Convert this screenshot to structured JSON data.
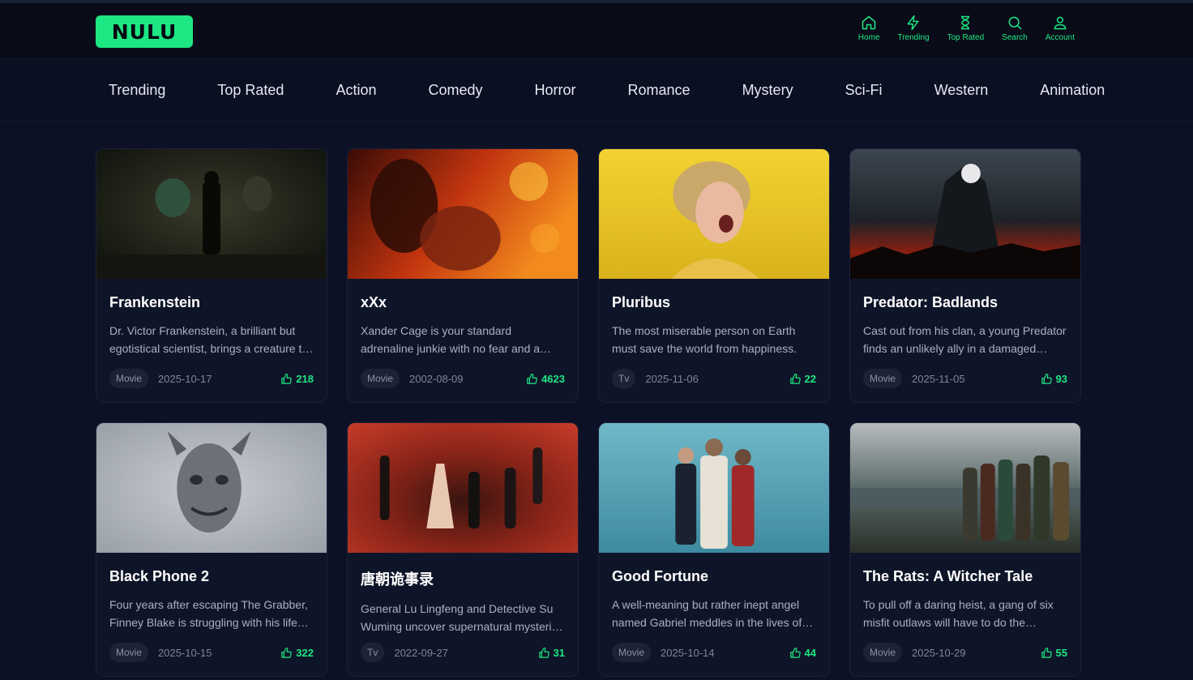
{
  "brand": {
    "name": "NULU",
    "accent": "#1ce783",
    "background": "#0d1126"
  },
  "nav": [
    {
      "label": "Home",
      "icon": "home-icon"
    },
    {
      "label": "Trending",
      "icon": "lightning-icon"
    },
    {
      "label": "Top Rated",
      "icon": "trophy-icon"
    },
    {
      "label": "Search",
      "icon": "search-icon"
    },
    {
      "label": "Account",
      "icon": "user-icon"
    }
  ],
  "genres": [
    "Trending",
    "Top Rated",
    "Action",
    "Comedy",
    "Horror",
    "Romance",
    "Mystery",
    "Sci-Fi",
    "Western",
    "Animation"
  ],
  "cards": [
    {
      "title": "Frankenstein",
      "desc": "Dr. Victor Frankenstein, a brilliant but egotistical scientist, brings a creature to life in a monstrous experiment.",
      "type": "Movie",
      "date": "2025-10-17",
      "likes": "218"
    },
    {
      "title": "xXx",
      "desc": "Xander Cage is your standard adrenaline junkie with no fear and a lousy attitude.",
      "type": "Movie",
      "date": "2002-08-09",
      "likes": "4623"
    },
    {
      "title": "Pluribus",
      "desc": "The most miserable person on Earth must save the world from happiness.",
      "type": "Tv",
      "date": "2025-11-06",
      "likes": "22"
    },
    {
      "title": "Predator: Badlands",
      "desc": "Cast out from his clan, a young Predator finds an unlikely ally in a damaged android.",
      "type": "Movie",
      "date": "2025-11-05",
      "likes": "93"
    },
    {
      "title": "Black Phone 2",
      "desc": "Four years after escaping The Grabber, Finney Blake is struggling with his life after captivity.",
      "type": "Movie",
      "date": "2025-10-15",
      "likes": "322"
    },
    {
      "title": "唐朝诡事录",
      "desc": "General Lu Lingfeng and Detective Su Wuming uncover supernatural mysteries in the Tang Dynasty.",
      "type": "Tv",
      "date": "2022-09-27",
      "likes": "31"
    },
    {
      "title": "Good Fortune",
      "desc": "A well-meaning but rather inept angel named Gabriel meddles in the lives of others.",
      "type": "Movie",
      "date": "2025-10-14",
      "likes": "44"
    },
    {
      "title": "The Rats: A Witcher Tale",
      "desc": "To pull off a daring heist, a gang of six misfit outlaws will have to do the unthinkable.",
      "type": "Movie",
      "date": "2025-10-29",
      "likes": "55"
    }
  ]
}
